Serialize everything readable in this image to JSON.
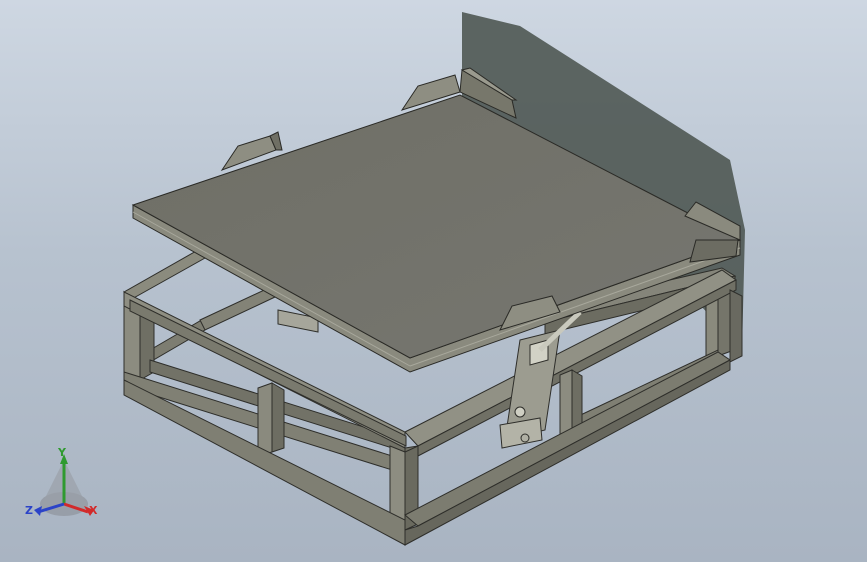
{
  "viewport": {
    "background_top": "#ced7e2",
    "background_bottom": "#a9b4c2",
    "model_color": "#7d7d71",
    "model_shadow": "#505a55"
  },
  "triad": {
    "x_label": "X",
    "y_label": "Y",
    "z_label": "Z",
    "x_color": "#d22a2a",
    "y_color": "#2f9a2f",
    "z_color": "#2b43c8"
  }
}
